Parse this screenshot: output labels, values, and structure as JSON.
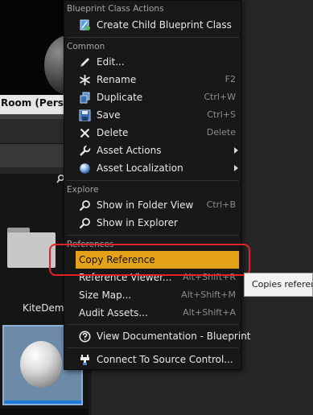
{
  "background": {
    "viewport_label": "Room (Persiste",
    "asset_folder_label": "KiteDemo"
  },
  "menu": {
    "sections": {
      "blueprint": "Blueprint Class Actions",
      "common": "Common",
      "explore": "Explore",
      "references": "References"
    },
    "items": {
      "create_child": {
        "label": "Create Child Blueprint Class",
        "icon": "blueprint-icon"
      },
      "edit": {
        "label": "Edit...",
        "icon": "edit-icon"
      },
      "rename": {
        "label": "Rename",
        "shortcut": "F2",
        "icon": "rename-icon"
      },
      "duplicate": {
        "label": "Duplicate",
        "shortcut": "Ctrl+W",
        "icon": "duplicate-icon"
      },
      "save": {
        "label": "Save",
        "shortcut": "Ctrl+S",
        "icon": "save-icon"
      },
      "delete": {
        "label": "Delete",
        "shortcut": "Delete",
        "icon": "delete-icon"
      },
      "asset_actions": {
        "label": "Asset Actions",
        "icon": "wrench-icon"
      },
      "asset_localization": {
        "label": "Asset Localization",
        "icon": "globe-icon"
      },
      "show_in_folder_view": {
        "label": "Show in Folder View",
        "shortcut": "Ctrl+B",
        "icon": "search-icon"
      },
      "show_in_explorer": {
        "label": "Show in Explorer",
        "icon": "search-icon"
      },
      "copy_reference": {
        "label": "Copy Reference"
      },
      "reference_viewer": {
        "label": "Reference Viewer...",
        "shortcut": "Alt+Shift+R"
      },
      "size_map": {
        "label": "Size Map...",
        "shortcut": "Alt+Shift+M"
      },
      "audit_assets": {
        "label": "Audit Assets...",
        "shortcut": "Alt+Shift+A"
      },
      "view_documentation": {
        "label": "View Documentation - Blueprint",
        "icon": "help-icon"
      },
      "connect_source_control": {
        "label": "Connect To Source Control...",
        "icon": "source-control-icon"
      }
    }
  },
  "tooltip": {
    "text": "Copies referenc"
  },
  "colors": {
    "highlight": "#e4a217",
    "annotation": "#e32323",
    "menu_bg": "#181818"
  }
}
